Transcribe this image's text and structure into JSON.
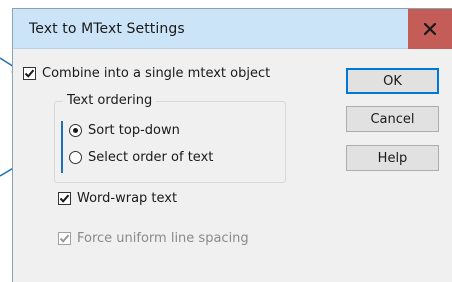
{
  "dialog": {
    "title": "Text to MText Settings",
    "close_icon": "close-x-icon",
    "close_color": "#c45c58",
    "titlebar_color": "#cce4f7"
  },
  "options": {
    "combine": {
      "label": "Combine into a single mtext object",
      "checked": true
    },
    "word_wrap": {
      "label": "Word-wrap text",
      "checked": true
    },
    "force_spacing": {
      "label": "Force uniform line spacing",
      "checked": true,
      "disabled": true
    }
  },
  "text_ordering": {
    "title": "Text ordering",
    "options": [
      {
        "label": "Sort top-down",
        "selected": true
      },
      {
        "label": "Select order of text",
        "selected": false
      }
    ]
  },
  "buttons": {
    "ok": "OK",
    "cancel": "Cancel",
    "help": "Help"
  },
  "accent_color": "#1f6fb2"
}
